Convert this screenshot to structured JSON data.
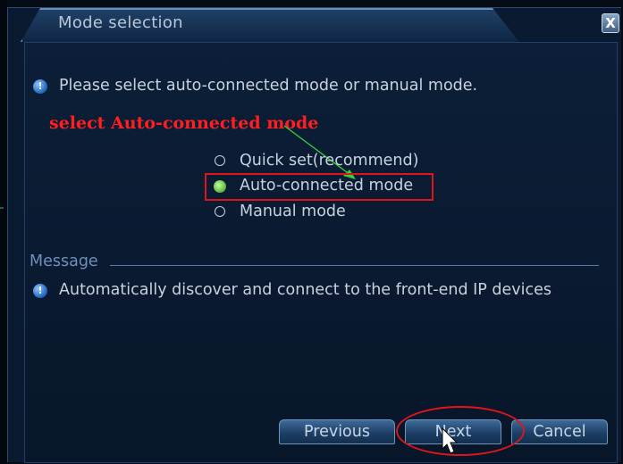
{
  "window": {
    "title": "Mode selection",
    "close_label": "X"
  },
  "prompt": {
    "icon": "info-icon",
    "text": "Please select auto-connected mode or manual mode."
  },
  "annotation": {
    "label": "select Auto-connected mode",
    "color": "#e0151c",
    "arrow_color": "#2fd43a"
  },
  "mode_options": [
    {
      "label": "Quick set(recommend)",
      "selected": false
    },
    {
      "label": "Auto-connected mode",
      "selected": true
    },
    {
      "label": "Manual mode",
      "selected": false
    }
  ],
  "message": {
    "header": "Message",
    "icon": "info-icon",
    "text": "Automatically discover and connect to the front-end IP devices"
  },
  "buttons": {
    "previous": "Previous",
    "next": "Next",
    "cancel": "Cancel"
  },
  "colors": {
    "panel_bg": "#0a1a30",
    "text": "#c8d2de",
    "accent_blue": "#6f8fbd",
    "selected_radio": "#55b83a"
  }
}
